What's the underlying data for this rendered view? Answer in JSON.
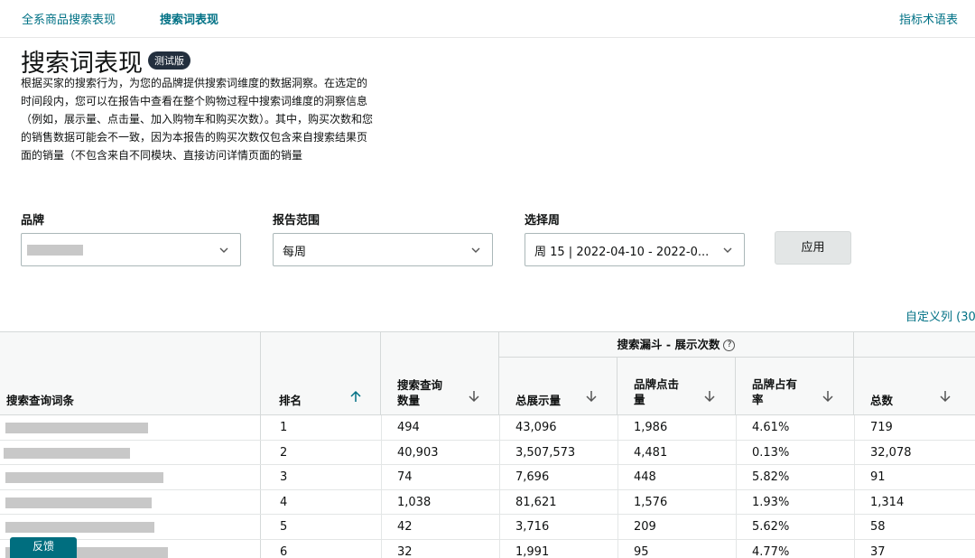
{
  "nav": {
    "link_all": "全系商品搜索表现",
    "link_search": "搜索词表现",
    "glossary": "指标术语表"
  },
  "page": {
    "title": "搜索词表现",
    "badge": "测试版",
    "description": "根据买家的搜索行为，为您的品牌提供搜索词维度的数据洞察。在选定的时间段内，您可以在报告中查看在整个购物过程中搜索词维度的洞察信息（例如，展示量、点击量、加入购物车和购买次数）。其中，购买次数和您的销售数据可能会不一致，因为本报告的购买次数仅包含来自搜索结果页面的销量（不包含来自不同模块、直接访问详情页面的销量"
  },
  "filters": {
    "brand_label": "品牌",
    "brand_value": "",
    "scope_label": "报告范围",
    "scope_value": "每周",
    "week_label": "选择周",
    "week_value": "周 15 | 2022-04-10 - 2022-0...",
    "apply": "应用"
  },
  "customize": "自定义列 (30",
  "table": {
    "group_header": "搜索漏斗 - 展示次数",
    "info_icon": "?",
    "columns": {
      "query": "搜索查询词条",
      "rank": "排名",
      "volume_1": "搜索查询",
      "volume_2": "数量",
      "impressions": "总展示量",
      "brand_clicks_1": "品牌点击",
      "brand_clicks_2": "量",
      "share_1": "品牌占有",
      "share_2": "率",
      "total": "总数"
    },
    "rows": [
      {
        "rank": "1",
        "volume": "494",
        "impressions": "43,096",
        "clicks": "1,986",
        "share": "4.61%",
        "total": "719"
      },
      {
        "rank": "2",
        "volume": "40,903",
        "impressions": "3,507,573",
        "clicks": "4,481",
        "share": "0.13%",
        "total": "32,078"
      },
      {
        "rank": "3",
        "volume": "74",
        "impressions": "7,696",
        "clicks": "448",
        "share": "5.82%",
        "total": "91"
      },
      {
        "rank": "4",
        "volume": "1,038",
        "impressions": "81,621",
        "clicks": "1,576",
        "share": "1.93%",
        "total": "1,314"
      },
      {
        "rank": "5",
        "volume": "42",
        "impressions": "3,716",
        "clicks": "209",
        "share": "5.62%",
        "total": "58"
      },
      {
        "rank": "6",
        "volume": "32",
        "impressions": "1,991",
        "clicks": "95",
        "share": "4.77%",
        "total": "37"
      }
    ]
  },
  "feedback": "反馈"
}
